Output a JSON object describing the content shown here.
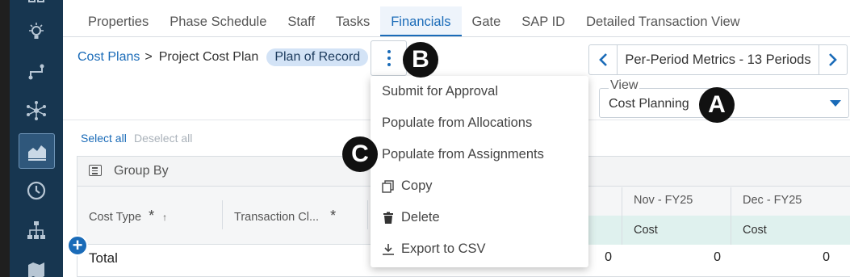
{
  "tabs": [
    {
      "label": "Properties",
      "active": false
    },
    {
      "label": "Phase Schedule",
      "active": false
    },
    {
      "label": "Staff",
      "active": false
    },
    {
      "label": "Tasks",
      "active": false
    },
    {
      "label": "Financials",
      "active": true
    },
    {
      "label": "Gate",
      "active": false
    },
    {
      "label": "SAP ID",
      "active": false
    },
    {
      "label": "Detailed Transaction View",
      "active": false
    }
  ],
  "breadcrumb": {
    "root": "Cost Plans",
    "separator": ">",
    "current": "Project Cost Plan",
    "badge": "Plan of Record"
  },
  "markers": {
    "a": "A",
    "b": "B",
    "c": "C"
  },
  "period_nav": {
    "label": "Per-Period Metrics - 13 Periods"
  },
  "view": {
    "legend": "View",
    "value": "Cost Planning"
  },
  "selection": {
    "select_all": "Select all",
    "deselect_all": "Deselect all"
  },
  "grid": {
    "group_by": "Group By",
    "columns": {
      "cost_type": "Cost Type",
      "transaction_class": "Transaction Cl...",
      "nov": "Nov - FY25",
      "dec": "Dec - FY25"
    },
    "sub_headers": [
      "Cost",
      "Cost"
    ],
    "total_label": "Total",
    "total_values": [
      "0",
      "0",
      "0"
    ]
  },
  "menu": {
    "items": [
      {
        "label": "Submit for Approval",
        "icon": ""
      },
      {
        "label": "Populate from Allocations",
        "icon": ""
      },
      {
        "label": "Populate from Assignments",
        "icon": ""
      },
      {
        "label": "Copy",
        "icon": "copy-icon"
      },
      {
        "label": "Delete",
        "icon": "trash-icon"
      },
      {
        "label": "Export to CSV",
        "icon": "export-icon"
      }
    ]
  },
  "colors": {
    "accent": "#1a6bb8",
    "rail": "#173650",
    "teal_header": "#dff1ee",
    "badge_bg": "#d3e3f6"
  }
}
